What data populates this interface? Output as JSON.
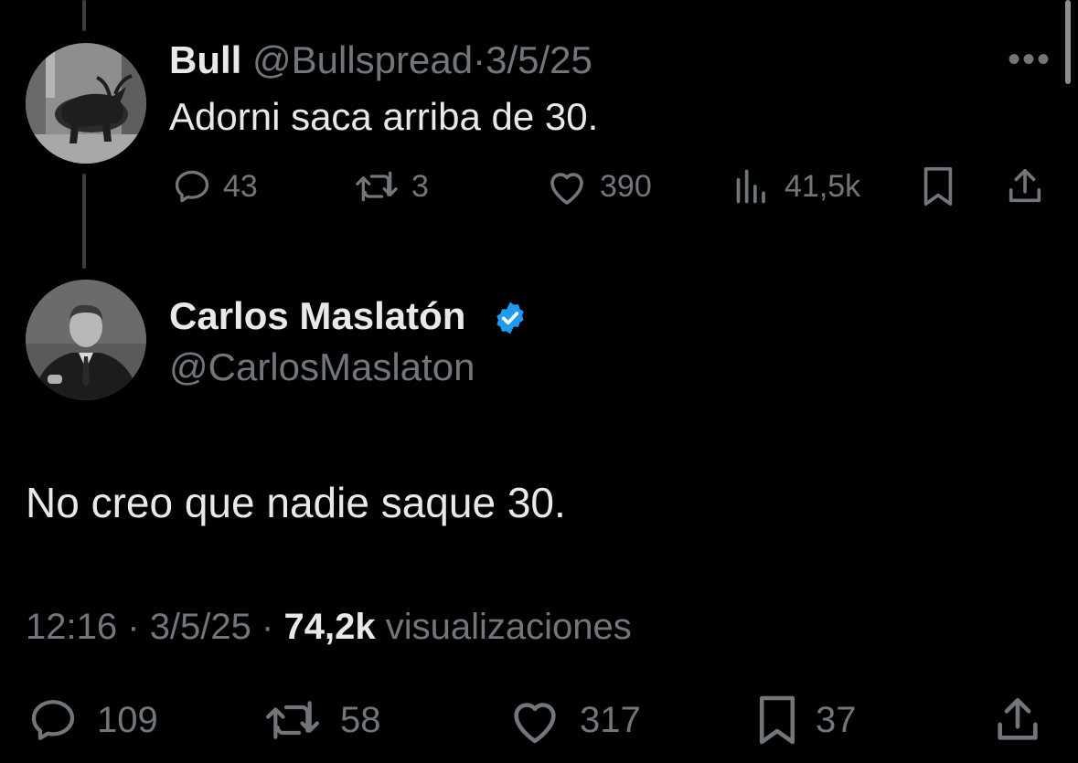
{
  "parent": {
    "name": "Bull",
    "handle": "@Bullspread",
    "separator": "·",
    "date": "3/5/25",
    "text": "Adorni saca arriba de 30.",
    "more": "•••",
    "actions": {
      "replies": "43",
      "reposts": "3",
      "likes": "390",
      "views": "41,5k"
    },
    "avatar_icon": "bull-statue-avatar"
  },
  "main": {
    "name": "Carlos Maslatón",
    "handle": "@CarlosMaslaton",
    "verified_color": "#1d9bf0",
    "text": "No creo que nadie saque 30.",
    "time": "12:16",
    "separator": "·",
    "date": "3/5/25",
    "views_count": "74,2k",
    "views_label": "visualizaciones",
    "actions": {
      "replies": "109",
      "reposts": "58",
      "likes": "317",
      "bookmarks": "37"
    },
    "avatar_icon": "man-in-suit-avatar"
  },
  "colors": {
    "background": "#000000",
    "text": "#e7e9ea",
    "muted": "#71767b",
    "thread_line": "#3a3d41",
    "accent": "#1d9bf0"
  }
}
